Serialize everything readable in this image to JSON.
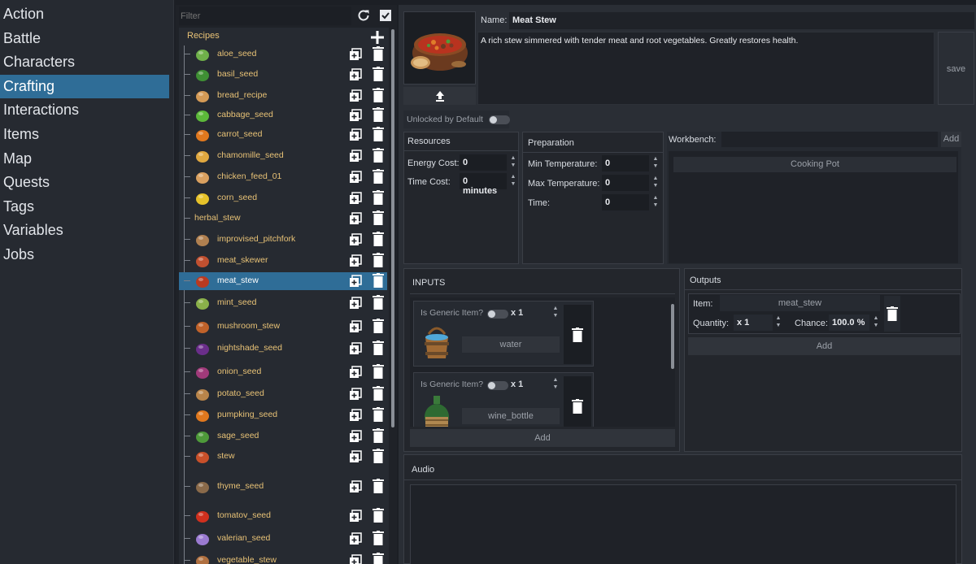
{
  "nav": {
    "items": [
      {
        "label": "Action",
        "active": false
      },
      {
        "label": "Battle",
        "active": false
      },
      {
        "label": "Characters",
        "active": false
      },
      {
        "label": "Crafting",
        "active": true
      },
      {
        "label": "Interactions",
        "active": false
      },
      {
        "label": "Items",
        "active": false
      },
      {
        "label": "Map",
        "active": false
      },
      {
        "label": "Quests",
        "active": false
      },
      {
        "label": "Tags",
        "active": false
      },
      {
        "label": "Variables",
        "active": false
      },
      {
        "label": "Jobs",
        "active": false
      }
    ]
  },
  "tree": {
    "filter_placeholder": "Filter",
    "root_label": "Recipes",
    "items": [
      {
        "label": "aloe_seed",
        "icon": "aloe-icon"
      },
      {
        "label": "basil_seed",
        "icon": "basil-icon"
      },
      {
        "label": "bread_recipe",
        "icon": "bread-icon"
      },
      {
        "label": "cabbage_seed",
        "icon": "cabbage-icon"
      },
      {
        "label": "carrot_seed",
        "icon": "carrot-icon"
      },
      {
        "label": "chamomille_seed",
        "icon": "chamomile-icon"
      },
      {
        "label": "chicken_feed_01",
        "icon": "feed-sack-icon"
      },
      {
        "label": "corn_seed",
        "icon": "corn-icon"
      },
      {
        "label": "herbal_stew",
        "icon": ""
      },
      {
        "label": "improvised_pitchfork",
        "icon": "pitchfork-icon"
      },
      {
        "label": "meat_skewer",
        "icon": "skewer-icon"
      },
      {
        "label": "meat_stew",
        "icon": "stew-bowl-icon",
        "selected": true
      },
      {
        "label": "mint_seed",
        "icon": "mint-icon"
      },
      {
        "label": "mushroom_stew",
        "icon": "mushroom-stew-icon"
      },
      {
        "label": "nightshade_seed",
        "icon": "nightshade-icon"
      },
      {
        "label": "onion_seed",
        "icon": "onion-icon"
      },
      {
        "label": "potato_seed",
        "icon": "potato-icon"
      },
      {
        "label": "pumpking_seed",
        "icon": "pumpkin-icon"
      },
      {
        "label": "sage_seed",
        "icon": "sage-icon"
      },
      {
        "label": "stew",
        "icon": "stew-icon"
      },
      {
        "label": "thyme_seed",
        "icon": "thyme-icon"
      },
      {
        "label": "tomatov_seed",
        "icon": "tomato-icon"
      },
      {
        "label": "valerian_seed",
        "icon": "valerian-icon"
      },
      {
        "label": "vegetable_stew",
        "icon": "vegetable-stew-icon"
      }
    ]
  },
  "recipe": {
    "name_label": "Name:",
    "name": "Meat Stew",
    "description": "A rich stew simmered with tender meat and root vegetables. Greatly restores health.",
    "save_label": "save",
    "unlocked_label": "Unlocked by Default",
    "unlocked": false
  },
  "resources": {
    "title": "Resources",
    "energy_label": "Energy Cost:",
    "energy_value": "0",
    "time_label": "Time Cost:",
    "time_value": "0 minutes"
  },
  "preparation": {
    "title": "Preparation",
    "min_label": "Min Temperature:",
    "min_value": "0",
    "max_label": "Max Temperature:",
    "max_value": "0",
    "time_label": "Time:",
    "time_value": "0"
  },
  "workbench": {
    "label": "Workbench:",
    "add_label": "Add",
    "items": [
      "Cooking Pot"
    ]
  },
  "inputs": {
    "title": "INPUTS",
    "generic_label": "Is Generic Item?",
    "items": [
      {
        "qty": "x 1",
        "name": "water",
        "icon": "water-bucket-icon"
      },
      {
        "qty": "x 1",
        "name": "wine_bottle",
        "icon": "wine-bottle-icon"
      }
    ],
    "add_label": "Add"
  },
  "outputs": {
    "title": "Outputs",
    "item_label": "Item:",
    "item_value": "meat_stew",
    "quantity_label": "Quantity:",
    "quantity_value": "x 1",
    "chance_label": "Chance:",
    "chance_value": "100.0 %",
    "add_label": "Add"
  },
  "audio": {
    "title": "Audio"
  },
  "colors": {
    "accent": "#2f6d97",
    "item_label": "#e8c276",
    "background": "#1c1f25"
  }
}
